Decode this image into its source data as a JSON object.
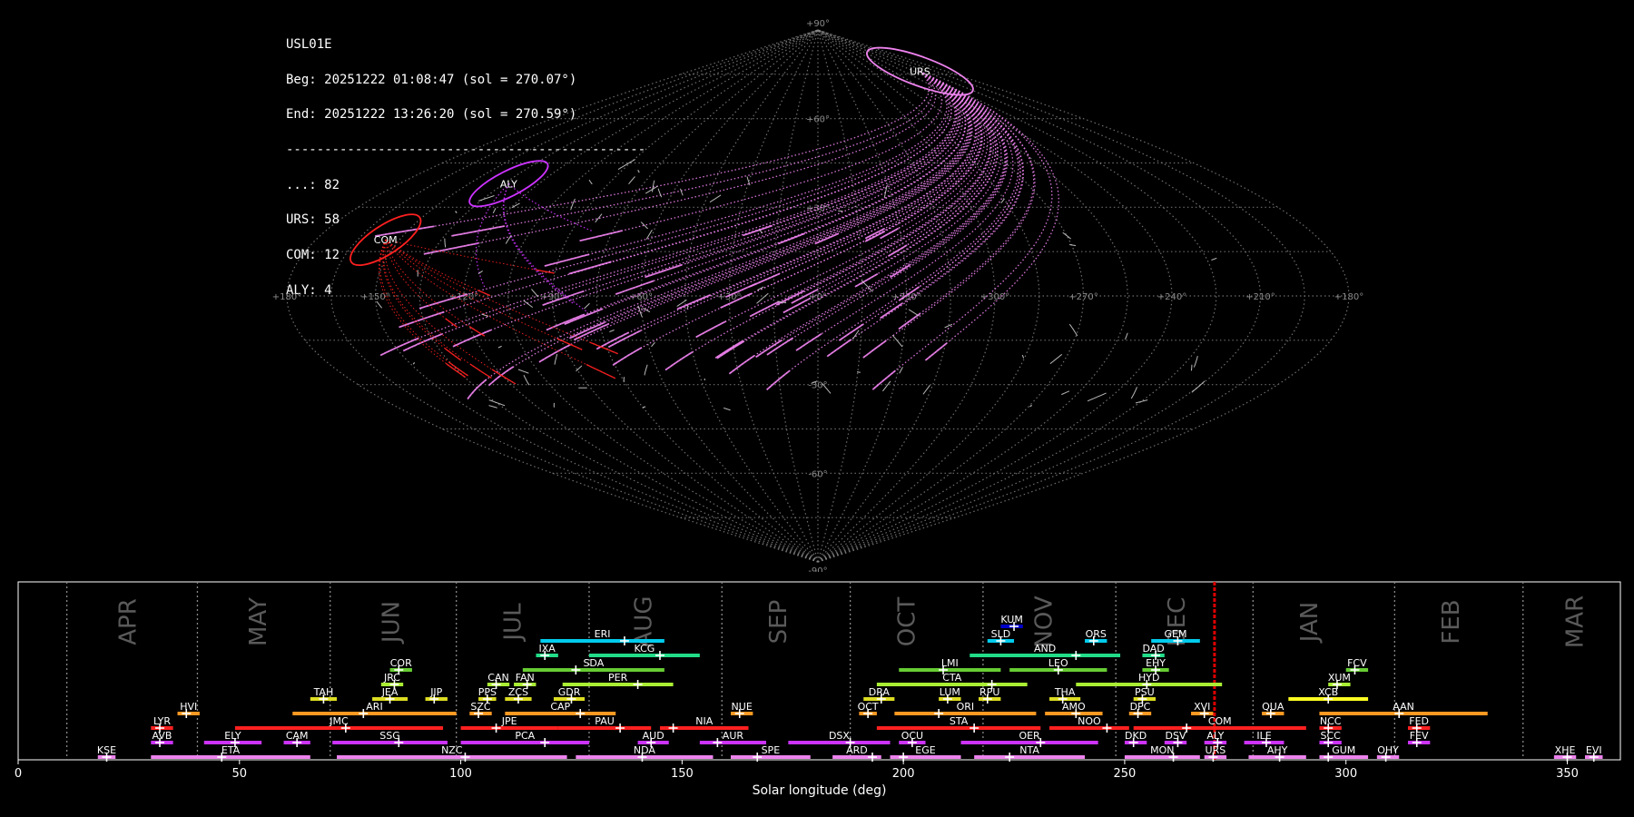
{
  "info": {
    "station": "USL01E",
    "begin": "Beg: 20251222 01:08:47 (sol = 270.07°)",
    "end": "End: 20251222 13:26:20 (sol = 270.59°)",
    "separator": "-----------------------------------------------",
    "counts": [
      "...: 82",
      "URS: 58",
      "COM: 12",
      "ALY: 4"
    ]
  },
  "colors": {
    "background": "#000000",
    "grid": "#888888",
    "sporadic": "#cccccc",
    "URS": "#ee82ee",
    "COM": "#ff2020",
    "ALY": "#cc33ff",
    "current": "#dd0000"
  },
  "chart_data": [
    {
      "type": "scatter",
      "projection": "sinusoidal",
      "ra_tick_labels": [
        "+180°",
        "+150°",
        "+120°",
        "+90°",
        "+60°",
        "+30°",
        "+0°",
        "+330°",
        "+300°",
        "+270°",
        "+240°",
        "+210°",
        "+180°"
      ],
      "dec_tick_labels": [
        "+90°",
        "+60°",
        "+30°",
        "-30°",
        "-60°",
        "-90°"
      ],
      "radiants": [
        {
          "name": "URS",
          "ra": 217,
          "dec": 76
        },
        {
          "name": "COM",
          "ra": 155,
          "dec": 19
        },
        {
          "name": "ALY",
          "ra": 133,
          "dec": 38
        }
      ],
      "grid": true
    },
    {
      "type": "gantt",
      "xlabel": "Solar longitude (deg)",
      "xlim": [
        0,
        362
      ],
      "x_ticks": [
        0,
        50,
        100,
        150,
        200,
        250,
        300,
        350
      ],
      "months": [
        {
          "label": "APR",
          "x": 25
        },
        {
          "label": "MAY",
          "x": 54.5
        },
        {
          "label": "JUN",
          "x": 84.5
        },
        {
          "label": "JUL",
          "x": 112
        },
        {
          "label": "AUG",
          "x": 141.5
        },
        {
          "label": "SEP",
          "x": 172
        },
        {
          "label": "OCT",
          "x": 201
        },
        {
          "label": "NOV",
          "x": 232
        },
        {
          "label": "DEC",
          "x": 262
        },
        {
          "label": "JAN",
          "x": 292
        },
        {
          "label": "FEB",
          "x": 324
        },
        {
          "label": "MAR",
          "x": 352
        }
      ],
      "month_boundaries": [
        11,
        40.5,
        70.5,
        99,
        129,
        159,
        188,
        218,
        248,
        279,
        311,
        340
      ],
      "current_sol": 270.3,
      "showers": [
        {
          "code": "KUM",
          "start": 222,
          "end": 227,
          "peak": 225,
          "row": 9,
          "color": "#0000cc"
        },
        {
          "code": "ERI",
          "start": 118,
          "end": 146,
          "peak": 137,
          "row": 8,
          "color": "#00ccee"
        },
        {
          "code": "SLD",
          "start": 219,
          "end": 225,
          "peak": 222,
          "row": 8,
          "color": "#00ccee"
        },
        {
          "code": "ORS",
          "start": 241,
          "end": 246,
          "peak": 243,
          "row": 8,
          "color": "#00ccee"
        },
        {
          "code": "GEM",
          "start": 256,
          "end": 267,
          "peak": 262,
          "row": 8,
          "color": "#00ccee"
        },
        {
          "code": "IXA",
          "start": 117,
          "end": 122,
          "peak": 119,
          "row": 7,
          "color": "#22dd88"
        },
        {
          "code": "KCG",
          "start": 129,
          "end": 154,
          "peak": 145,
          "row": 7,
          "color": "#22dd88"
        },
        {
          "code": "AND",
          "start": 215,
          "end": 249,
          "peak": 239,
          "row": 7,
          "color": "#22dd88"
        },
        {
          "code": "DAD",
          "start": 254,
          "end": 259,
          "peak": 257,
          "row": 7,
          "color": "#22dd88"
        },
        {
          "code": "COR",
          "start": 84,
          "end": 89,
          "peak": 86,
          "row": 6,
          "color": "#66cc33"
        },
        {
          "code": "SDA",
          "start": 114,
          "end": 146,
          "peak": 126,
          "row": 6,
          "color": "#66cc33"
        },
        {
          "code": "LMI",
          "start": 199,
          "end": 222,
          "peak": 209,
          "row": 6,
          "color": "#66cc33"
        },
        {
          "code": "LEO",
          "start": 224,
          "end": 246,
          "peak": 235,
          "row": 6,
          "color": "#66cc33"
        },
        {
          "code": "EHY",
          "start": 254,
          "end": 260,
          "peak": 257,
          "row": 6,
          "color": "#66cc33"
        },
        {
          "code": "FCV",
          "start": 300,
          "end": 305,
          "peak": 302,
          "row": 6,
          "color": "#66cc33"
        },
        {
          "code": "JRC",
          "start": 82,
          "end": 87,
          "peak": 85,
          "row": 5,
          "color": "#aaee33"
        },
        {
          "code": "CAN",
          "start": 106,
          "end": 111,
          "peak": 108,
          "row": 5,
          "color": "#aaee33"
        },
        {
          "code": "FAN",
          "start": 112,
          "end": 117,
          "peak": 115,
          "row": 5,
          "color": "#aaee33"
        },
        {
          "code": "PER",
          "start": 123,
          "end": 148,
          "peak": 140,
          "row": 5,
          "color": "#aaee33"
        },
        {
          "code": "CTA",
          "start": 194,
          "end": 228,
          "peak": 220,
          "row": 5,
          "color": "#aaee33"
        },
        {
          "code": "HYD",
          "start": 239,
          "end": 272,
          "peak": 255,
          "row": 5,
          "color": "#aaee33"
        },
        {
          "code": "XUM",
          "start": 296,
          "end": 301,
          "peak": 298,
          "row": 5,
          "color": "#aaee33"
        },
        {
          "code": "TAH",
          "start": 66,
          "end": 72,
          "peak": 69,
          "row": 4,
          "color": "#dddd22"
        },
        {
          "code": "JEA",
          "start": 80,
          "end": 88,
          "peak": 84,
          "row": 4,
          "color": "#dddd22"
        },
        {
          "code": "JIP",
          "start": 92,
          "end": 97,
          "peak": 94,
          "row": 4,
          "color": "#dddd22"
        },
        {
          "code": "PPS",
          "start": 104,
          "end": 108,
          "peak": 106,
          "row": 4,
          "color": "#dddd22"
        },
        {
          "code": "ZCS",
          "start": 110,
          "end": 116,
          "peak": 113,
          "row": 4,
          "color": "#dddd22"
        },
        {
          "code": "GDR",
          "start": 121,
          "end": 128,
          "peak": 125,
          "row": 4,
          "color": "#dddd22"
        },
        {
          "code": "DRA",
          "start": 191,
          "end": 198,
          "peak": 195,
          "row": 4,
          "color": "#dddd22"
        },
        {
          "code": "LUM",
          "start": 208,
          "end": 213,
          "peak": 210,
          "row": 4,
          "color": "#dddd22"
        },
        {
          "code": "RPU",
          "start": 217,
          "end": 222,
          "peak": 219,
          "row": 4,
          "color": "#dddd22"
        },
        {
          "code": "THA",
          "start": 233,
          "end": 240,
          "peak": 236,
          "row": 4,
          "color": "#dddd22"
        },
        {
          "code": "PSU",
          "start": 252,
          "end": 257,
          "peak": 254,
          "row": 4,
          "color": "#dddd22"
        },
        {
          "code": "XCB",
          "start": 287,
          "end": 305,
          "peak": 296,
          "row": 4,
          "color": "#ffff22"
        },
        {
          "code": "HVI",
          "start": 36,
          "end": 41,
          "peak": 38,
          "row": 3,
          "color": "#ff9922"
        },
        {
          "code": "ARI",
          "start": 62,
          "end": 99,
          "peak": 78,
          "row": 3,
          "color": "#ff9922"
        },
        {
          "code": "SZC",
          "start": 102,
          "end": 107,
          "peak": 104,
          "row": 3,
          "color": "#ff9922"
        },
        {
          "code": "CAP",
          "start": 110,
          "end": 135,
          "peak": 127,
          "row": 3,
          "color": "#ff9922"
        },
        {
          "code": "NUE",
          "start": 161,
          "end": 166,
          "peak": 163,
          "row": 3,
          "color": "#ff9922"
        },
        {
          "code": "OCT",
          "start": 190,
          "end": 194,
          "peak": 192,
          "row": 3,
          "color": "#ff9922"
        },
        {
          "code": "ORI",
          "start": 198,
          "end": 230,
          "peak": 208,
          "row": 3,
          "color": "#ff9922"
        },
        {
          "code": "AMO",
          "start": 232,
          "end": 245,
          "peak": 239,
          "row": 3,
          "color": "#ff9922"
        },
        {
          "code": "DPC",
          "start": 251,
          "end": 256,
          "peak": 253,
          "row": 3,
          "color": "#ff9922"
        },
        {
          "code": "XVI",
          "start": 265,
          "end": 270,
          "peak": 268,
          "row": 3,
          "color": "#ff9922"
        },
        {
          "code": "QUA",
          "start": 281,
          "end": 286,
          "peak": 283,
          "row": 3,
          "color": "#ff9922"
        },
        {
          "code": "AAN",
          "start": 294,
          "end": 332,
          "peak": 312,
          "row": 3,
          "color": "#ff9922"
        },
        {
          "code": "LYR",
          "start": 30,
          "end": 35,
          "peak": 32,
          "row": 2,
          "color": "#ff2020"
        },
        {
          "code": "JMC",
          "start": 49,
          "end": 96,
          "peak": 74,
          "row": 2,
          "color": "#ff2020"
        },
        {
          "code": "JPE",
          "start": 100,
          "end": 122,
          "peak": 108,
          "row": 2,
          "color": "#ff2020"
        },
        {
          "code": "PAU",
          "start": 122,
          "end": 143,
          "peak": 136,
          "row": 2,
          "color": "#ff2020"
        },
        {
          "code": "NIA",
          "start": 145,
          "end": 165,
          "peak": 148,
          "row": 2,
          "color": "#ff2020"
        },
        {
          "code": "STA",
          "start": 194,
          "end": 231,
          "peak": 216,
          "row": 2,
          "color": "#ff2020"
        },
        {
          "code": "NOO",
          "start": 233,
          "end": 251,
          "peak": 246,
          "row": 2,
          "color": "#ff2020"
        },
        {
          "code": "COM",
          "start": 252,
          "end": 291,
          "peak": 264,
          "row": 2,
          "color": "#ff2020"
        },
        {
          "code": "NCC",
          "start": 294,
          "end": 299,
          "peak": 296,
          "row": 2,
          "color": "#ff2020"
        },
        {
          "code": "FED",
          "start": 314,
          "end": 319,
          "peak": 316,
          "row": 2,
          "color": "#ff2020"
        },
        {
          "code": "AVB",
          "start": 30,
          "end": 35,
          "peak": 32,
          "row": 1,
          "color": "#cc33ff"
        },
        {
          "code": "ELY",
          "start": 42,
          "end": 55,
          "peak": 49,
          "row": 1,
          "color": "#cc33ff"
        },
        {
          "code": "CAM",
          "start": 60,
          "end": 66,
          "peak": 63,
          "row": 1,
          "color": "#cc33ff"
        },
        {
          "code": "SSG",
          "start": 71,
          "end": 97,
          "peak": 86,
          "row": 1,
          "color": "#cc33ff"
        },
        {
          "code": "PCA",
          "start": 100,
          "end": 129,
          "peak": 119,
          "row": 1,
          "color": "#cc33ff"
        },
        {
          "code": "AUD",
          "start": 140,
          "end": 147,
          "peak": 143,
          "row": 1,
          "color": "#cc33ff"
        },
        {
          "code": "AUR",
          "start": 154,
          "end": 169,
          "peak": 158,
          "row": 1,
          "color": "#cc33ff"
        },
        {
          "code": "DSX",
          "start": 174,
          "end": 197,
          "peak": 188,
          "row": 1,
          "color": "#cc33ff"
        },
        {
          "code": "OCU",
          "start": 199,
          "end": 205,
          "peak": 202,
          "row": 1,
          "color": "#cc33ff"
        },
        {
          "code": "OER",
          "start": 213,
          "end": 244,
          "peak": 231,
          "row": 1,
          "color": "#cc33ff"
        },
        {
          "code": "DKD",
          "start": 250,
          "end": 255,
          "peak": 252,
          "row": 1,
          "color": "#cc33ff"
        },
        {
          "code": "DSV",
          "start": 259,
          "end": 264,
          "peak": 262,
          "row": 1,
          "color": "#cc33ff"
        },
        {
          "code": "ALY",
          "start": 268,
          "end": 273,
          "peak": 271,
          "row": 1,
          "color": "#cc33ff"
        },
        {
          "code": "ILE",
          "start": 277,
          "end": 286,
          "peak": 282,
          "row": 1,
          "color": "#cc33ff"
        },
        {
          "code": "SCC",
          "start": 294,
          "end": 299,
          "peak": 296,
          "row": 1,
          "color": "#cc33ff"
        },
        {
          "code": "FEV",
          "start": 314,
          "end": 319,
          "peak": 316,
          "row": 1,
          "color": "#cc33ff"
        },
        {
          "code": "KSE",
          "start": 18,
          "end": 22,
          "peak": 20,
          "row": 0,
          "color": "#ee82ee"
        },
        {
          "code": "ETA",
          "start": 30,
          "end": 66,
          "peak": 46,
          "row": 0,
          "color": "#ee82ee"
        },
        {
          "code": "NZC",
          "start": 72,
          "end": 124,
          "peak": 101,
          "row": 0,
          "color": "#ee82ee"
        },
        {
          "code": "NDA",
          "start": 126,
          "end": 157,
          "peak": 141,
          "row": 0,
          "color": "#ee82ee"
        },
        {
          "code": "SPE",
          "start": 161,
          "end": 179,
          "peak": 167,
          "row": 0,
          "color": "#ee82ee"
        },
        {
          "code": "ARD",
          "start": 184,
          "end": 195,
          "peak": 193,
          "row": 0,
          "color": "#ee82ee"
        },
        {
          "code": "EGE",
          "start": 197,
          "end": 213,
          "peak": 200,
          "row": 0,
          "color": "#ee82ee"
        },
        {
          "code": "NTA",
          "start": 216,
          "end": 241,
          "peak": 224,
          "row": 0,
          "color": "#ee82ee"
        },
        {
          "code": "MON",
          "start": 250,
          "end": 267,
          "peak": 261,
          "row": 0,
          "color": "#ee82ee"
        },
        {
          "code": "URS",
          "start": 268,
          "end": 273,
          "peak": 270,
          "row": 0,
          "color": "#ee82ee"
        },
        {
          "code": "AHY",
          "start": 278,
          "end": 291,
          "peak": 285,
          "row": 0,
          "color": "#ee82ee"
        },
        {
          "code": "GUM",
          "start": 294,
          "end": 305,
          "peak": 296,
          "row": 0,
          "color": "#ee82ee"
        },
        {
          "code": "OHY",
          "start": 307,
          "end": 312,
          "peak": 309,
          "row": 0,
          "color": "#ee82ee"
        },
        {
          "code": "XHE",
          "start": 347,
          "end": 352,
          "peak": 350,
          "row": 0,
          "color": "#ee82ee"
        },
        {
          "code": "EVI",
          "start": 354,
          "end": 358,
          "peak": 356,
          "row": 0,
          "color": "#ee82ee"
        }
      ]
    }
  ]
}
